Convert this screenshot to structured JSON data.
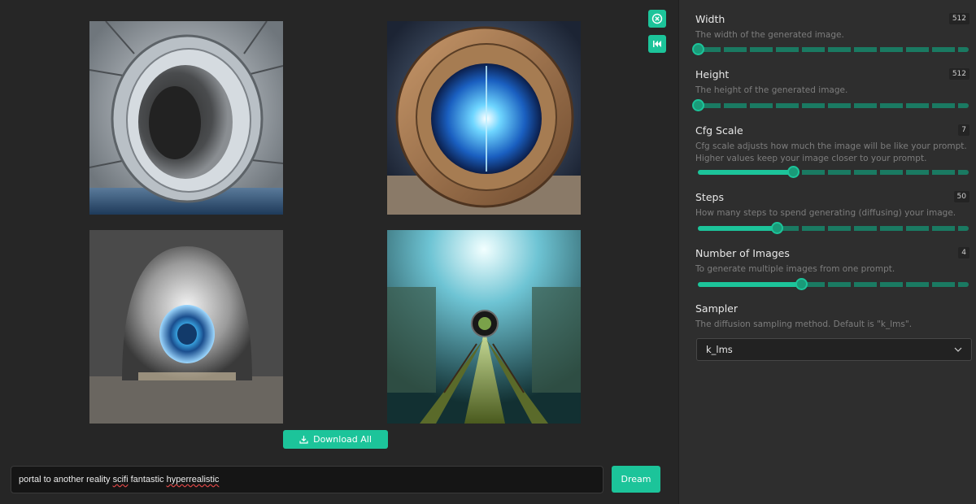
{
  "gallery": {
    "images": [
      {
        "name": "generated-image-1"
      },
      {
        "name": "generated-image-2"
      },
      {
        "name": "generated-image-3"
      },
      {
        "name": "generated-image-4"
      }
    ],
    "download_all_label": "Download All",
    "close_icon": "close-circle-icon",
    "skip_icon": "skip-back-icon"
  },
  "prompt": {
    "text_before": "portal to another reality ",
    "misspelled_1": "scifi",
    "text_middle": " fantastic ",
    "misspelled_2": "hyperrealistic",
    "dream_label": "Dream"
  },
  "settings": [
    {
      "label": "Width",
      "description": "The width of the generated image.",
      "value": "512",
      "fill": 0.0
    },
    {
      "label": "Height",
      "description": "The height of the generated image.",
      "value": "512",
      "fill": 0.0
    },
    {
      "label": "Cfg Scale",
      "description": "Cfg scale adjusts how much the image will be like your prompt. Higher values keep your image closer to your prompt.",
      "value": "7",
      "fill": 0.35
    },
    {
      "label": "Steps",
      "description": "How many steps to spend generating (diffusing) your image.",
      "value": "50",
      "fill": 0.29
    },
    {
      "label": "Number of Images",
      "description": "To generate multiple images from one prompt.",
      "value": "4",
      "fill": 0.38
    }
  ],
  "sampler": {
    "label": "Sampler",
    "description": "The diffusion sampling method. Default is \"k_lms\".",
    "selected": "k_lms"
  },
  "colors": {
    "accent": "#1cc49a",
    "panel_bg": "#2e2e2e",
    "main_bg": "#262626"
  }
}
